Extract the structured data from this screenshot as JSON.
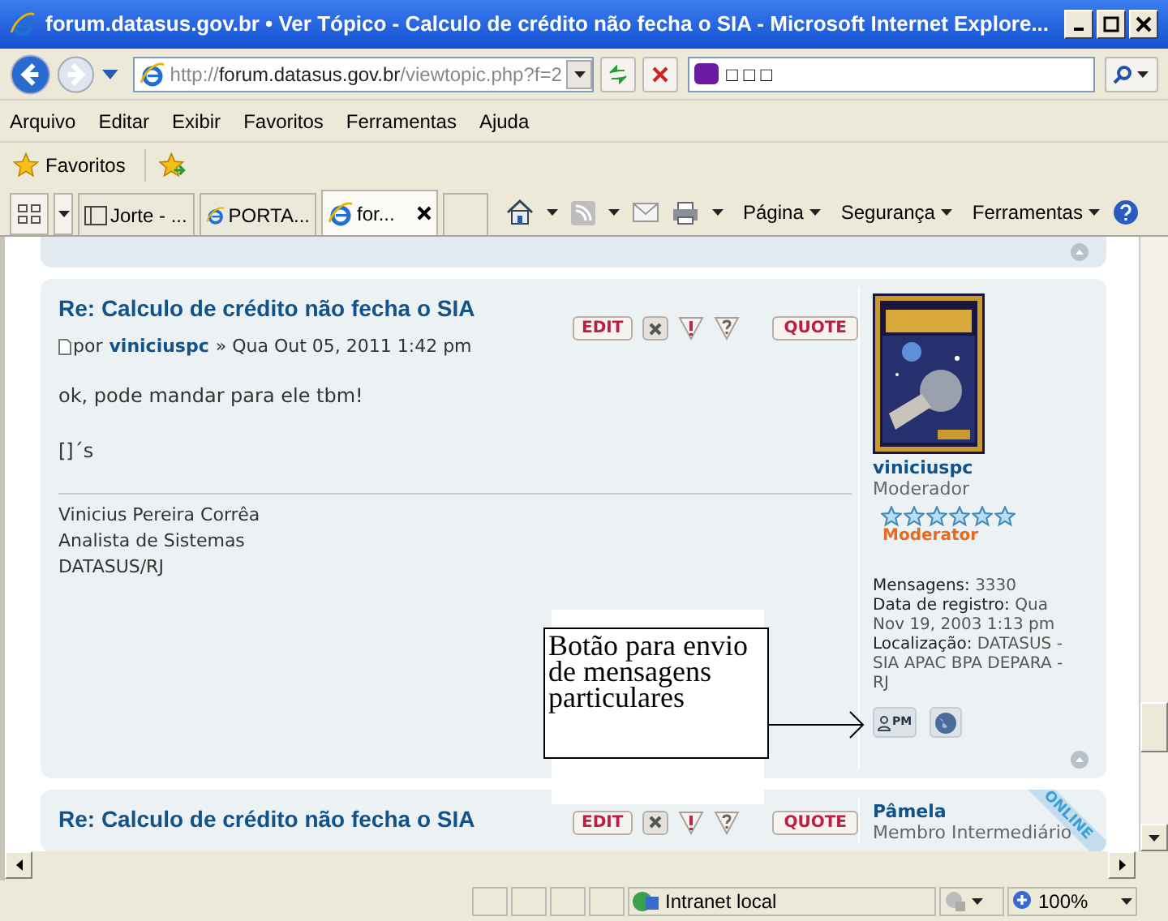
{
  "window": {
    "title": "forum.datasus.gov.br • Ver Tópico - Calculo de crédito não fecha o SIA - Microsoft Internet Explore..."
  },
  "address": {
    "scheme": "http://",
    "host": "forum.datasus.gov.br",
    "path": "/viewtopic.php?f=2"
  },
  "search": {
    "value": "□ □ □"
  },
  "menu": [
    "Arquivo",
    "Editar",
    "Exibir",
    "Favoritos",
    "Ferramentas",
    "Ajuda"
  ],
  "favorites": {
    "label": "Favoritos"
  },
  "tabs": [
    {
      "label": "Jorte - ...",
      "kind": "page",
      "selected": false
    },
    {
      "label": "PORTA...",
      "kind": "ie",
      "selected": false
    },
    {
      "label": "for...",
      "kind": "ie",
      "selected": true
    }
  ],
  "commands": [
    "Página",
    "Segurança",
    "Ferramentas"
  ],
  "posts": [
    {
      "title": "Re: Calculo de crédito não fecha o SIA",
      "by": "por",
      "author": "viniciuspc",
      "date": "» Qua Out 05, 2011 1:42 pm",
      "edit_label": "EDIT",
      "quote_label": "QUOTE",
      "body": [
        "ok, pode mandar para ele tbm!",
        "[]´s"
      ],
      "signature": [
        "Vinicius Pereira Corrêa",
        "Analista de Sistemas",
        "DATASUS/RJ"
      ],
      "profile": {
        "username": "viniciuspc",
        "rank": "Moderador",
        "stars": 6,
        "rank_title": "Moderator",
        "online": false,
        "stats": [
          {
            "label": "Mensagens:",
            "value": "3330"
          },
          {
            "label": "Data de registro:",
            "value": "Qua Nov 19, 2003 1:13 pm"
          },
          {
            "label": "Localização:",
            "value": "DATASUS - SIA APAC BPA DEPARA - RJ"
          }
        ],
        "pm_label": "PM"
      }
    },
    {
      "title": "Re: Calculo de crédito não fecha o SIA",
      "edit_label": "EDIT",
      "quote_label": "QUOTE",
      "profile": {
        "username": "Pâmela",
        "rank": "Membro Intermediário",
        "online": true,
        "online_label": "ONLINE"
      }
    }
  ],
  "annotation": {
    "text": "Botão para envio de mensagens particulares"
  },
  "status_bar": {
    "zone": "Intranet local",
    "zoom": "100%"
  }
}
